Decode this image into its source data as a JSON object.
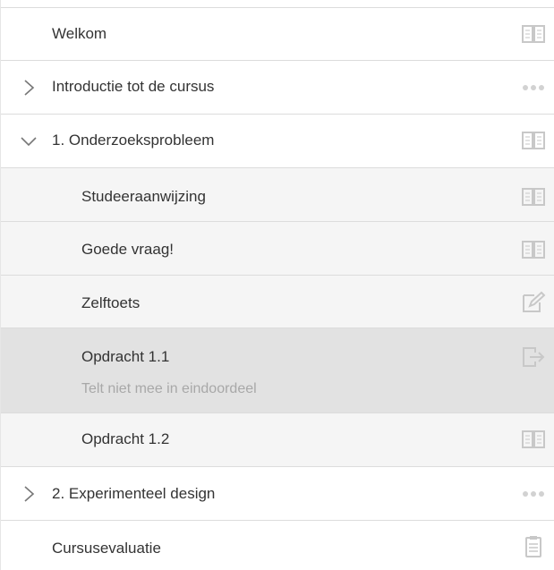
{
  "items": [
    {
      "label": "Welkom",
      "icon": "book-icon"
    },
    {
      "label": "Introductie tot de cursus",
      "icon": "ellipsis-icon",
      "expander": "chevron-right-icon"
    },
    {
      "label": "1. Onderzoeksprobleem",
      "icon": "book-icon",
      "expander": "chevron-down-icon"
    },
    {
      "label": "Studeeraanwijzing",
      "icon": "book-icon"
    },
    {
      "label": "Goede vraag!",
      "icon": "book-icon"
    },
    {
      "label": "Zelftoets",
      "icon": "edit-icon"
    },
    {
      "label": "Opdracht 1.1",
      "sublabel": "Telt niet mee in eindoordeel",
      "icon": "submit-icon",
      "state": "selected"
    },
    {
      "label": "Opdracht 1.2",
      "icon": "book-icon"
    },
    {
      "label": "2. Experimenteel design",
      "icon": "ellipsis-icon",
      "expander": "chevron-right-icon"
    },
    {
      "label": "Cursusevaluatie",
      "icon": "clipboard-icon"
    }
  ],
  "colors": {
    "border": "#dcdcdc",
    "sub_background": "#f5f5f5",
    "selected_background": "#e2e2e2",
    "icon": "#c8c8c8",
    "text": "#333333",
    "muted_text": "#a8a8a8"
  }
}
